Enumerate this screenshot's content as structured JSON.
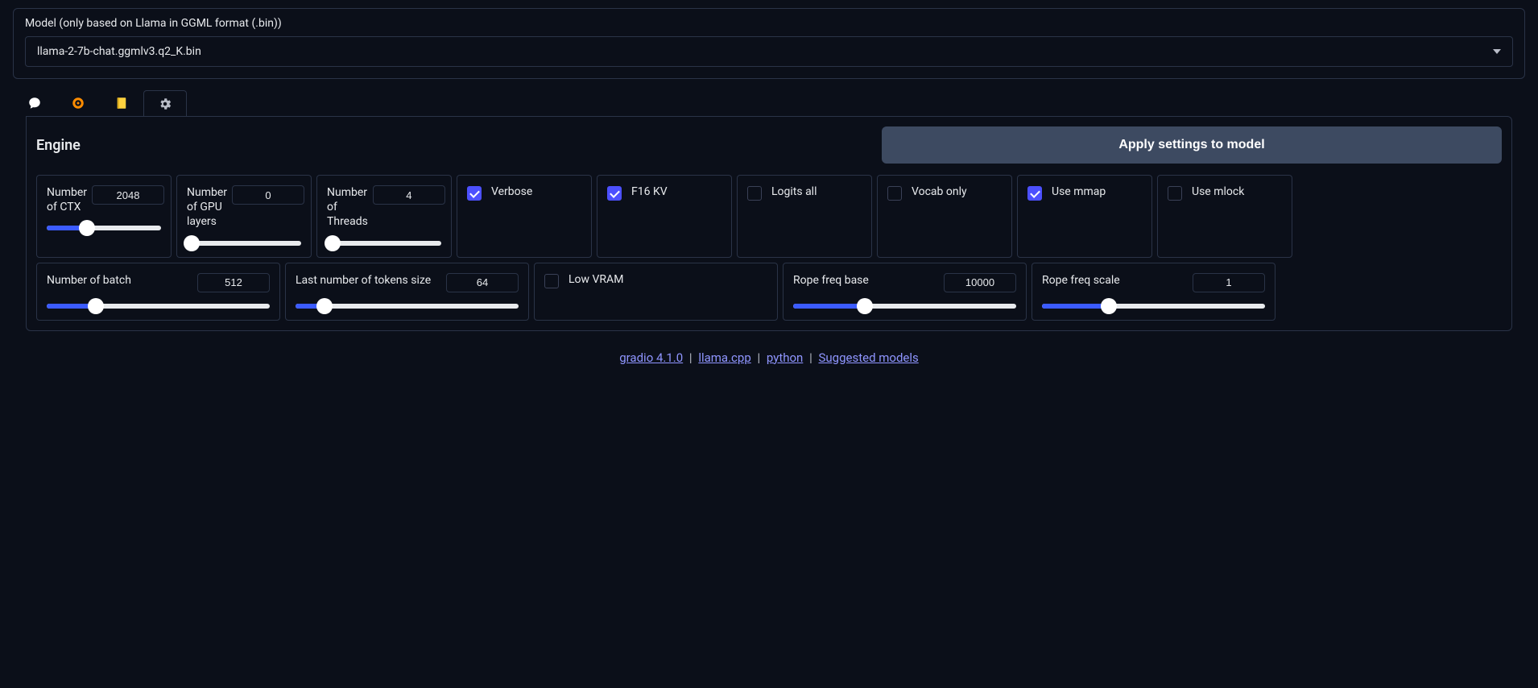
{
  "model": {
    "label": "Model (only based on Llama in GGML format (.bin))",
    "selected": "llama-2-7b-chat.ggmlv3.q2_K.bin"
  },
  "engine": {
    "title": "Engine",
    "apply_label": "Apply settings to model"
  },
  "sliders": {
    "n_ctx": {
      "label": "Number of CTX",
      "value": "2048",
      "pct": 35
    },
    "n_gpu": {
      "label": "Number of GPU layers",
      "value": "0",
      "pct": 4
    },
    "n_threads": {
      "label": "Number of Threads",
      "value": "4",
      "pct": 5
    },
    "n_batch": {
      "label": "Number of batch",
      "value": "512",
      "pct": 22
    },
    "n_last": {
      "label": "Last number of tokens size",
      "value": "64",
      "pct": 13
    },
    "rope_base": {
      "label": "Rope freq base",
      "value": "10000",
      "pct": 32
    },
    "rope_scale": {
      "label": "Rope freq scale",
      "value": "1",
      "pct": 30
    }
  },
  "checkboxes": {
    "verbose": {
      "label": "Verbose",
      "checked": true
    },
    "f16_kv": {
      "label": "F16 KV",
      "checked": true
    },
    "logits_all": {
      "label": "Logits all",
      "checked": false
    },
    "vocab_only": {
      "label": "Vocab only",
      "checked": false
    },
    "use_mmap": {
      "label": "Use mmap",
      "checked": true
    },
    "use_mlock": {
      "label": "Use mlock",
      "checked": false
    },
    "low_vram": {
      "label": "Low VRAM",
      "checked": false
    }
  },
  "footer": {
    "gradio": "gradio 4.1.0",
    "llama": "llama.cpp",
    "python": "python",
    "suggested": "Suggested models"
  }
}
